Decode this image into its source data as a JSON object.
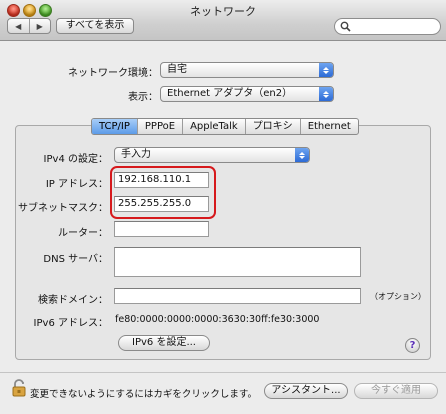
{
  "window": {
    "title": "ネットワーク"
  },
  "toolbar": {
    "back_glyph": "◀",
    "forward_glyph": "▶",
    "show_all_label": "すべてを表示",
    "search_placeholder": ""
  },
  "location": {
    "label": "ネットワーク環境：",
    "value": "自宅"
  },
  "show": {
    "label": "表示：",
    "value": "Ethernet アダプタ（en2）"
  },
  "tabs": [
    {
      "label": "TCP/IP",
      "active": true
    },
    {
      "label": "PPPoE",
      "active": false
    },
    {
      "label": "AppleTalk",
      "active": false
    },
    {
      "label": "プロキシ",
      "active": false
    },
    {
      "label": "Ethernet",
      "active": false
    }
  ],
  "ipv4": {
    "label": "IPv4 の設定：",
    "value": "手入力"
  },
  "ip_address": {
    "label": "IP アドレス：",
    "value": "192.168.110.1"
  },
  "subnet": {
    "label": "サブネットマスク：",
    "value": "255.255.255.0"
  },
  "router": {
    "label": "ルーター：",
    "value": ""
  },
  "dns": {
    "label": "DNS サーバ：",
    "value": ""
  },
  "search_domains": {
    "label": "検索ドメイン：",
    "value": "",
    "hint": "（オプション）"
  },
  "ipv6": {
    "label": "IPv6 アドレス：",
    "value": "fe80:0000:0000:0000:3630:30ff:fe30:3000",
    "button": "IPv6 を設定..."
  },
  "help": {
    "glyph": "?"
  },
  "footer": {
    "lock_text": "変更できないようにするにはカギをクリックします。",
    "assist_button": "アシスタント...",
    "apply_button": "今すぐ適用"
  },
  "colors": {
    "highlight": "#d6191c",
    "accent": "#3a7ce0"
  }
}
